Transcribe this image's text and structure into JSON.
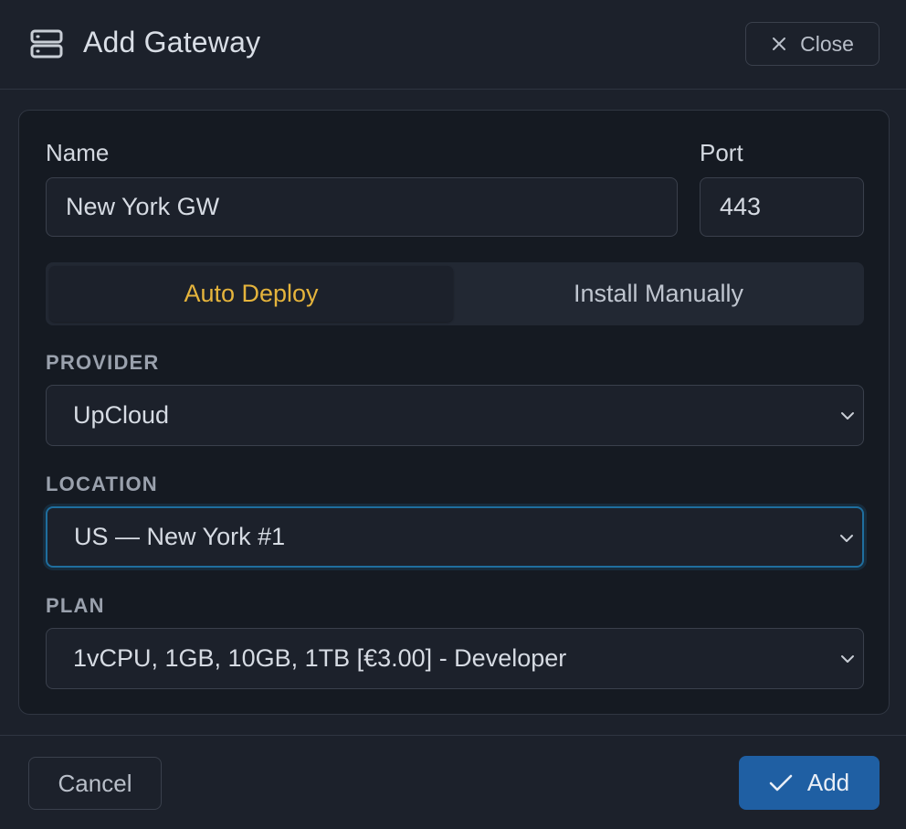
{
  "header": {
    "icon": "server-icon",
    "title": "Add Gateway",
    "close_icon": "close-icon",
    "close_label": "Close"
  },
  "form": {
    "name_label": "Name",
    "name_value": "New York GW",
    "port_label": "Port",
    "port_value": "443",
    "deploy_tabs": [
      {
        "label": "Auto Deploy",
        "active": true
      },
      {
        "label": "Install Manually",
        "active": false
      }
    ],
    "provider": {
      "label": "PROVIDER",
      "value": "UpCloud"
    },
    "location": {
      "label": "LOCATION",
      "value": "US — New York #1"
    },
    "plan": {
      "label": "PLAN",
      "value": "1vCPU, 1GB, 10GB, 1TB [€3.00] - Developer"
    }
  },
  "footer": {
    "cancel_label": "Cancel",
    "add_label": "Add",
    "add_icon": "check-icon"
  },
  "colors": {
    "background": "#1c212b",
    "card": "#151a22",
    "accent": "#e5b43c",
    "primary": "#1f5fa3",
    "focus": "#1f6e9e"
  }
}
